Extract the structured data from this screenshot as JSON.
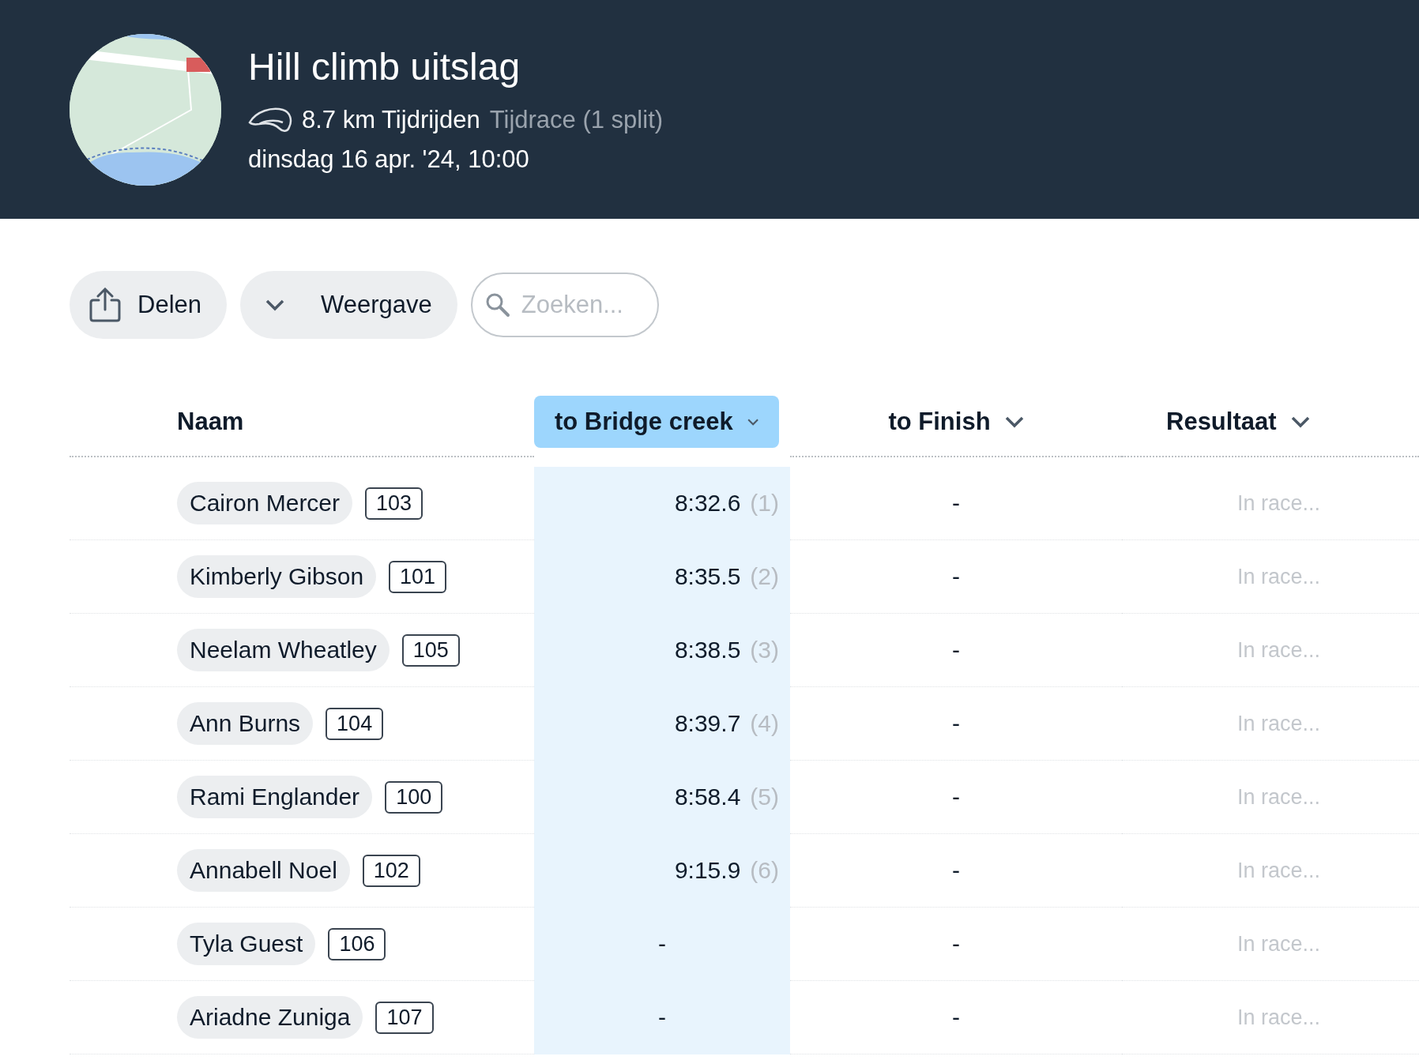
{
  "header": {
    "title": "Hill climb uitslag",
    "distance": "8.7 km Tijdrijden",
    "race_type": "Tijdrace (1 split)",
    "date": "dinsdag 16 apr. '24, 10:00"
  },
  "toolbar": {
    "share_button": "Delen",
    "view_button": "Weergave",
    "search": {
      "placeholder": "Zoeken..."
    }
  },
  "table": {
    "columns": [
      {
        "label": "Naam",
        "selected": false,
        "sortable": false
      },
      {
        "label": "to Bridge creek",
        "selected": true,
        "sortable": true
      },
      {
        "label": "to Finish",
        "selected": false,
        "sortable": true
      },
      {
        "label": "Resultaat",
        "selected": false,
        "sortable": true
      }
    ],
    "rows": [
      {
        "name": "Cairon Mercer",
        "bib": "103",
        "split_time": "8:32.6",
        "split_rank": "(1)",
        "finish": "-",
        "result": "In race..."
      },
      {
        "name": "Kimberly Gibson",
        "bib": "101",
        "split_time": "8:35.5",
        "split_rank": "(2)",
        "finish": "-",
        "result": "In race..."
      },
      {
        "name": "Neelam Wheatley",
        "bib": "105",
        "split_time": "8:38.5",
        "split_rank": "(3)",
        "finish": "-",
        "result": "In race..."
      },
      {
        "name": "Ann Burns",
        "bib": "104",
        "split_time": "8:39.7",
        "split_rank": "(4)",
        "finish": "-",
        "result": "In race..."
      },
      {
        "name": "Rami Englander",
        "bib": "100",
        "split_time": "8:58.4",
        "split_rank": "(5)",
        "finish": "-",
        "result": "In race..."
      },
      {
        "name": "Annabell Noel",
        "bib": "102",
        "split_time": "9:15.9",
        "split_rank": "(6)",
        "finish": "-",
        "result": "In race..."
      },
      {
        "name": "Tyla Guest",
        "bib": "106",
        "split_time": "-",
        "finish": "-",
        "result": "In race..."
      },
      {
        "name": "Ariadne Zuniga",
        "bib": "107",
        "split_time": "-",
        "finish": "-",
        "result": "In race..."
      }
    ]
  }
}
